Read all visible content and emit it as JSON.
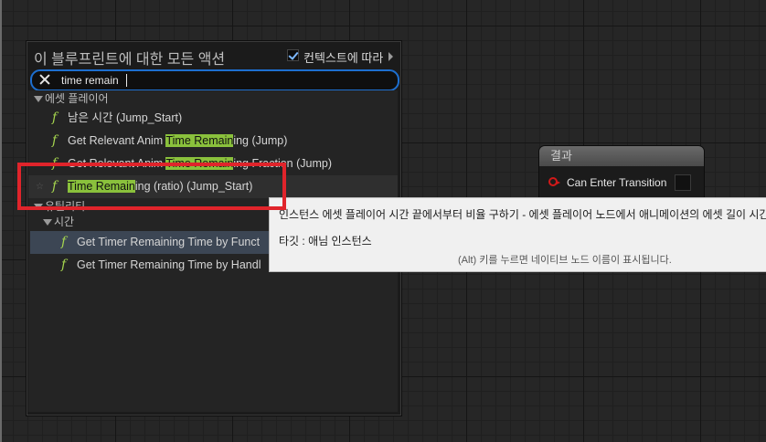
{
  "result_node": {
    "title": "결과",
    "pin_label": "Can Enter Transition"
  },
  "menu": {
    "title": "이 블루프린트에 대한 모든 액션",
    "context_label": "컨텍스트에 따라",
    "context_checked": true,
    "search_value": "time remain",
    "categories": {
      "asset_player": "에셋 플레이어",
      "utility": "유틸리티",
      "time": "시간"
    },
    "items": [
      {
        "text": "남은 시간 (Jump_Start)",
        "pre": "",
        "match": "",
        "post": ""
      },
      {
        "pre": "Get Relevant Anim ",
        "match": "Time Remain",
        "post": "ing (Jump)"
      },
      {
        "pre": "Get Relevant Anim ",
        "match": "Time Remain",
        "post": "ing Fraction (Jump)"
      },
      {
        "pre": "",
        "match": "Time Remain",
        "post": "ing (ratio) (Jump_Start)"
      },
      {
        "text": "Get Timer Remaining Time by Funct"
      },
      {
        "text": "Get Timer Remaining Time by Handl"
      }
    ],
    "function_icon": "f"
  },
  "tooltip": {
    "description": "인스턴스 에셋 플레이어 시간 끝에서부터 비율 구하기 - 에셋 플레이어 노드에서 애니메이션의 에셋 길이 시간을",
    "target": "타깃 : 애님 인스턴스",
    "hint": "(Alt) 키를 누르면 네이티브 노드 이름이 표시됩니다."
  },
  "colors": {
    "highlight": "#8ac13c",
    "function_icon": "#a6d64f",
    "search_border": "#1d6fd0",
    "annotation": "#e0242b"
  }
}
